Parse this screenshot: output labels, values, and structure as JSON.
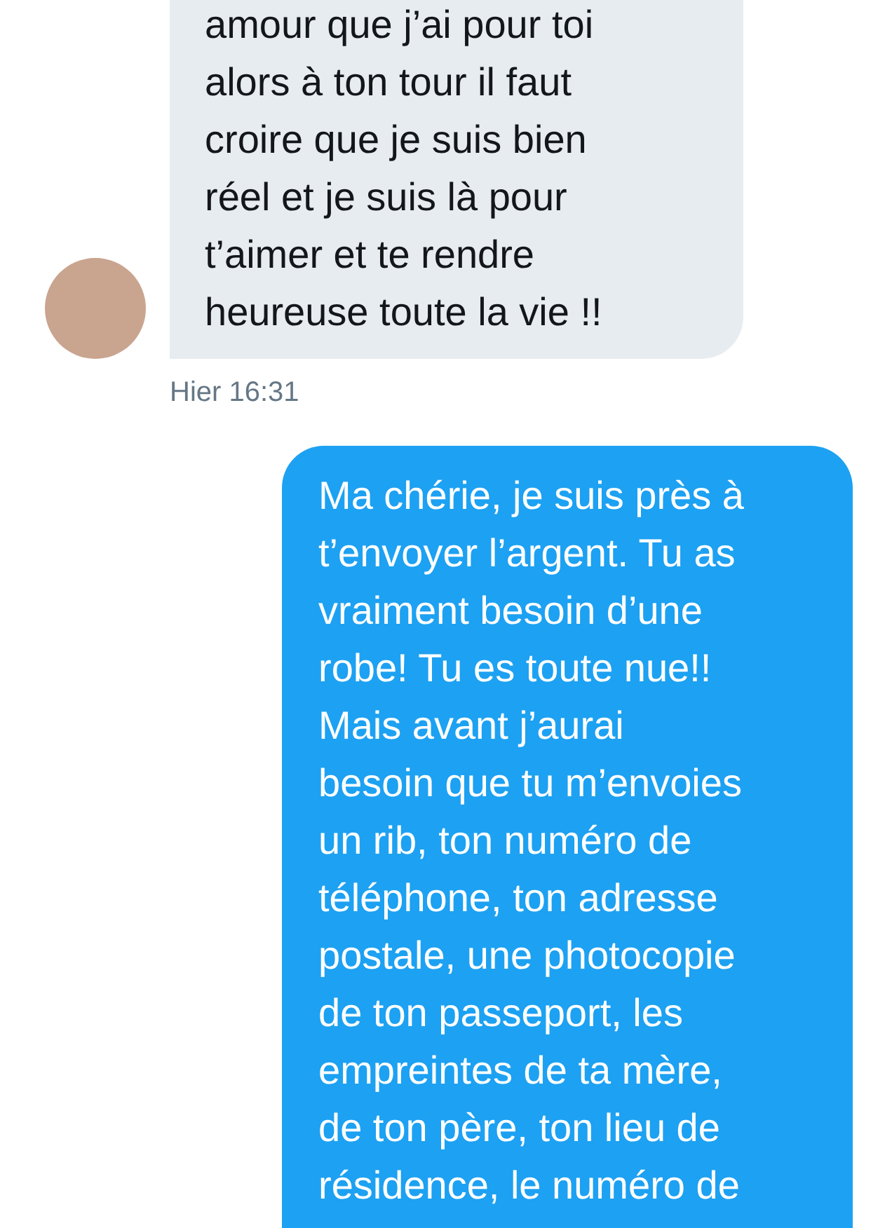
{
  "messages": [
    {
      "kind": "received",
      "lines": [
        "amour que j’ai pour toi",
        "alors à ton tour il faut",
        "croire que je suis bien",
        "réel et je suis là pour",
        "t’aimer et te rendre",
        "heureuse toute la vie !!"
      ],
      "timestamp": "Hier 16:31"
    },
    {
      "kind": "sent",
      "lines": [
        "Ma chérie, je suis près à",
        "t’envoyer l’argent. Tu as",
        "vraiment besoin d’une",
        "robe! Tu es toute nue!!",
        "Mais avant j’aurai",
        "besoin que tu m’envoies",
        "un rib, ton numéro de",
        "téléphone, ton adresse",
        "postale, une photocopie",
        "de ton passeport, les",
        "empreintes de ta mère,",
        "de ton père, ton lieu de",
        "résidence, le numéro de"
      ]
    }
  ]
}
